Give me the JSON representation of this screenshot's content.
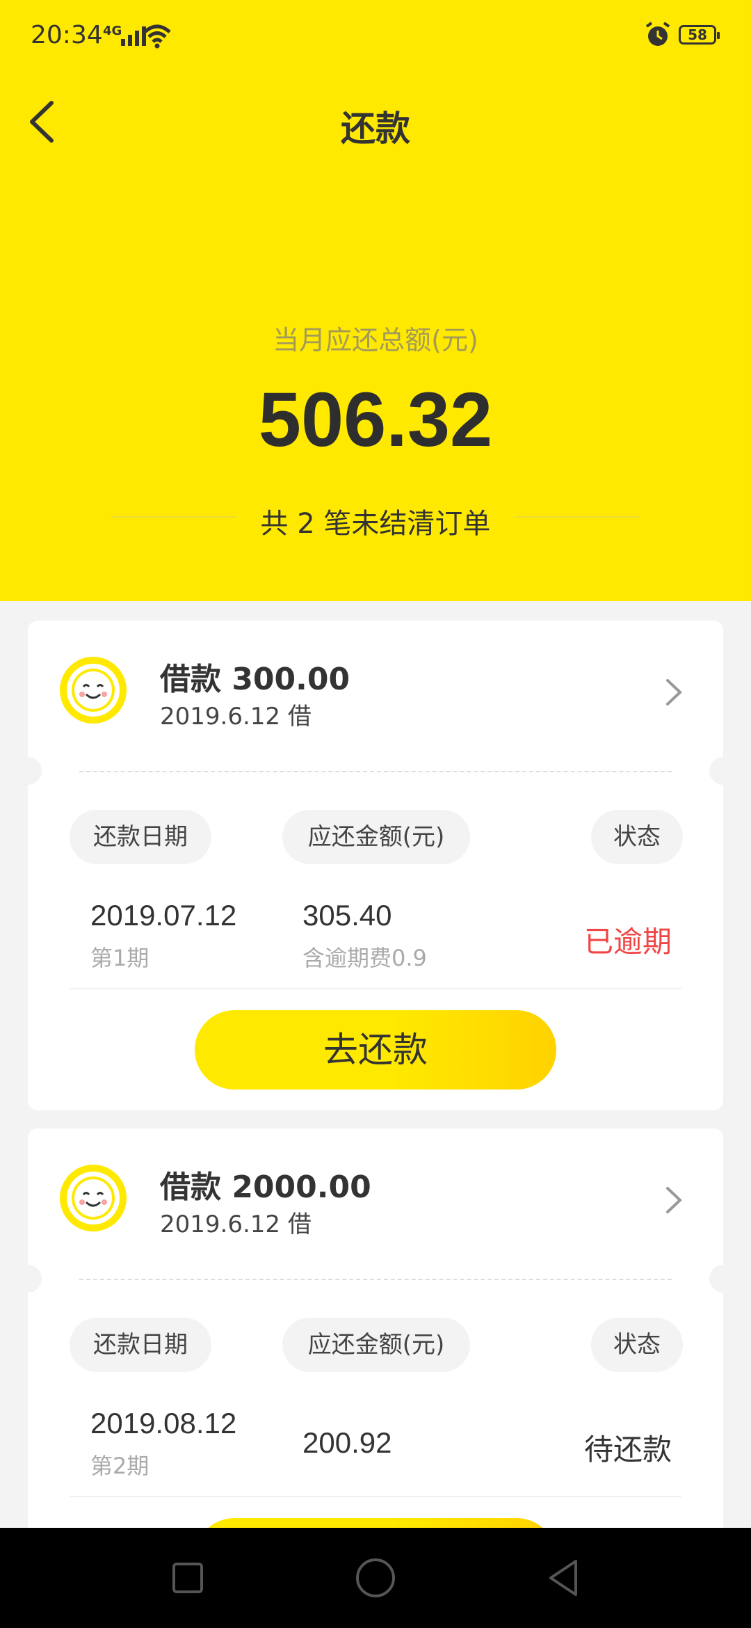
{
  "status_bar": {
    "time": "20:34",
    "network": "4G",
    "battery": "58"
  },
  "header": {
    "title": "还款",
    "total_label": "当月应还总额(元)",
    "total_amount": "506.32",
    "order_count": "共 2 笔未结清订单"
  },
  "table_headers": {
    "date": "还款日期",
    "amount": "应还金额(元)",
    "status": "状态"
  },
  "loans": [
    {
      "title": "借款 300.00",
      "borrow_date": "2019.6.12 借",
      "due_date": "2019.07.12",
      "period": "第1期",
      "amount": "305.40",
      "fee_note": "含逾期费0.9",
      "status": "已逾期",
      "status_color": "#f04646",
      "button": "去还款"
    },
    {
      "title": "借款 2000.00",
      "borrow_date": "2019.6.12 借",
      "due_date": "2019.08.12",
      "period": "第2期",
      "amount": "200.92",
      "status": "待还款",
      "status_color": "#333333"
    }
  ],
  "colors": {
    "brand_yellow": "#ffe900",
    "overdue_red": "#f04646"
  },
  "icons": [
    "back-arrow-icon",
    "smiley-avatar-icon",
    "chevron-right-icon",
    "nav-recents-icon",
    "nav-home-icon",
    "nav-back-icon"
  ]
}
